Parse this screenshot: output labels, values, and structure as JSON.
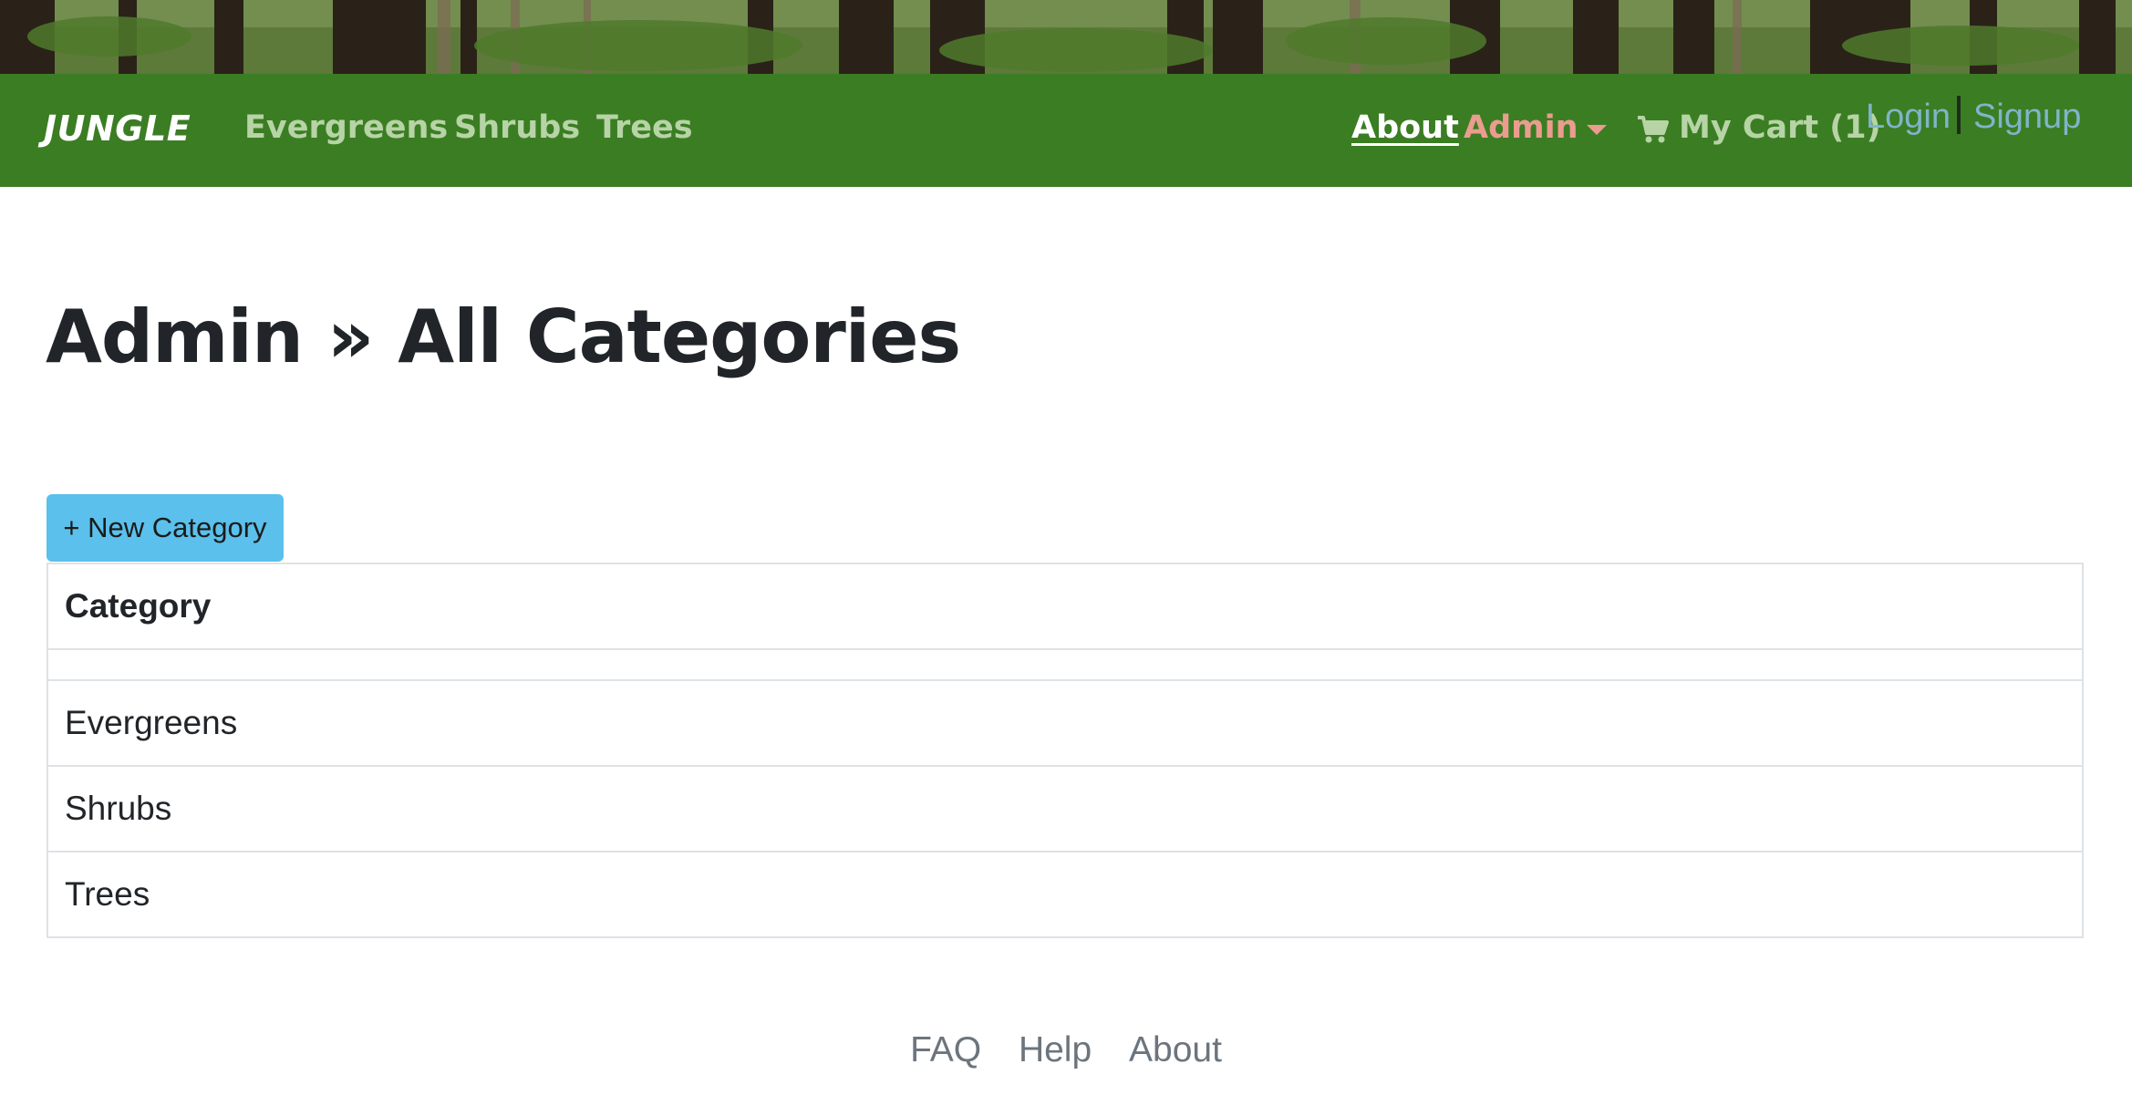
{
  "navbar": {
    "brand": "JUNGLE",
    "links": [
      "Evergreens",
      "Shrubs",
      "Trees"
    ],
    "about": "About",
    "admin": "Admin",
    "cart": "My Cart (1)",
    "login": "Login",
    "signup": "Signup"
  },
  "page": {
    "title": "Admin » All Categories",
    "new_button": "+ New Category"
  },
  "table": {
    "header": "Category",
    "rows": [
      "Evergreens",
      "Shrubs",
      "Trees"
    ]
  },
  "footer": {
    "links": [
      "FAQ",
      "Help",
      "About"
    ]
  },
  "colors": {
    "navbar": "#3b7d23",
    "nav_link": "#b7d4a6",
    "admin": "#ea9d8f",
    "auth_link": "#7fb5c9",
    "button": "#5bc0eb"
  },
  "icons": {
    "cart": "cart-icon",
    "caret": "caret-down-icon"
  }
}
